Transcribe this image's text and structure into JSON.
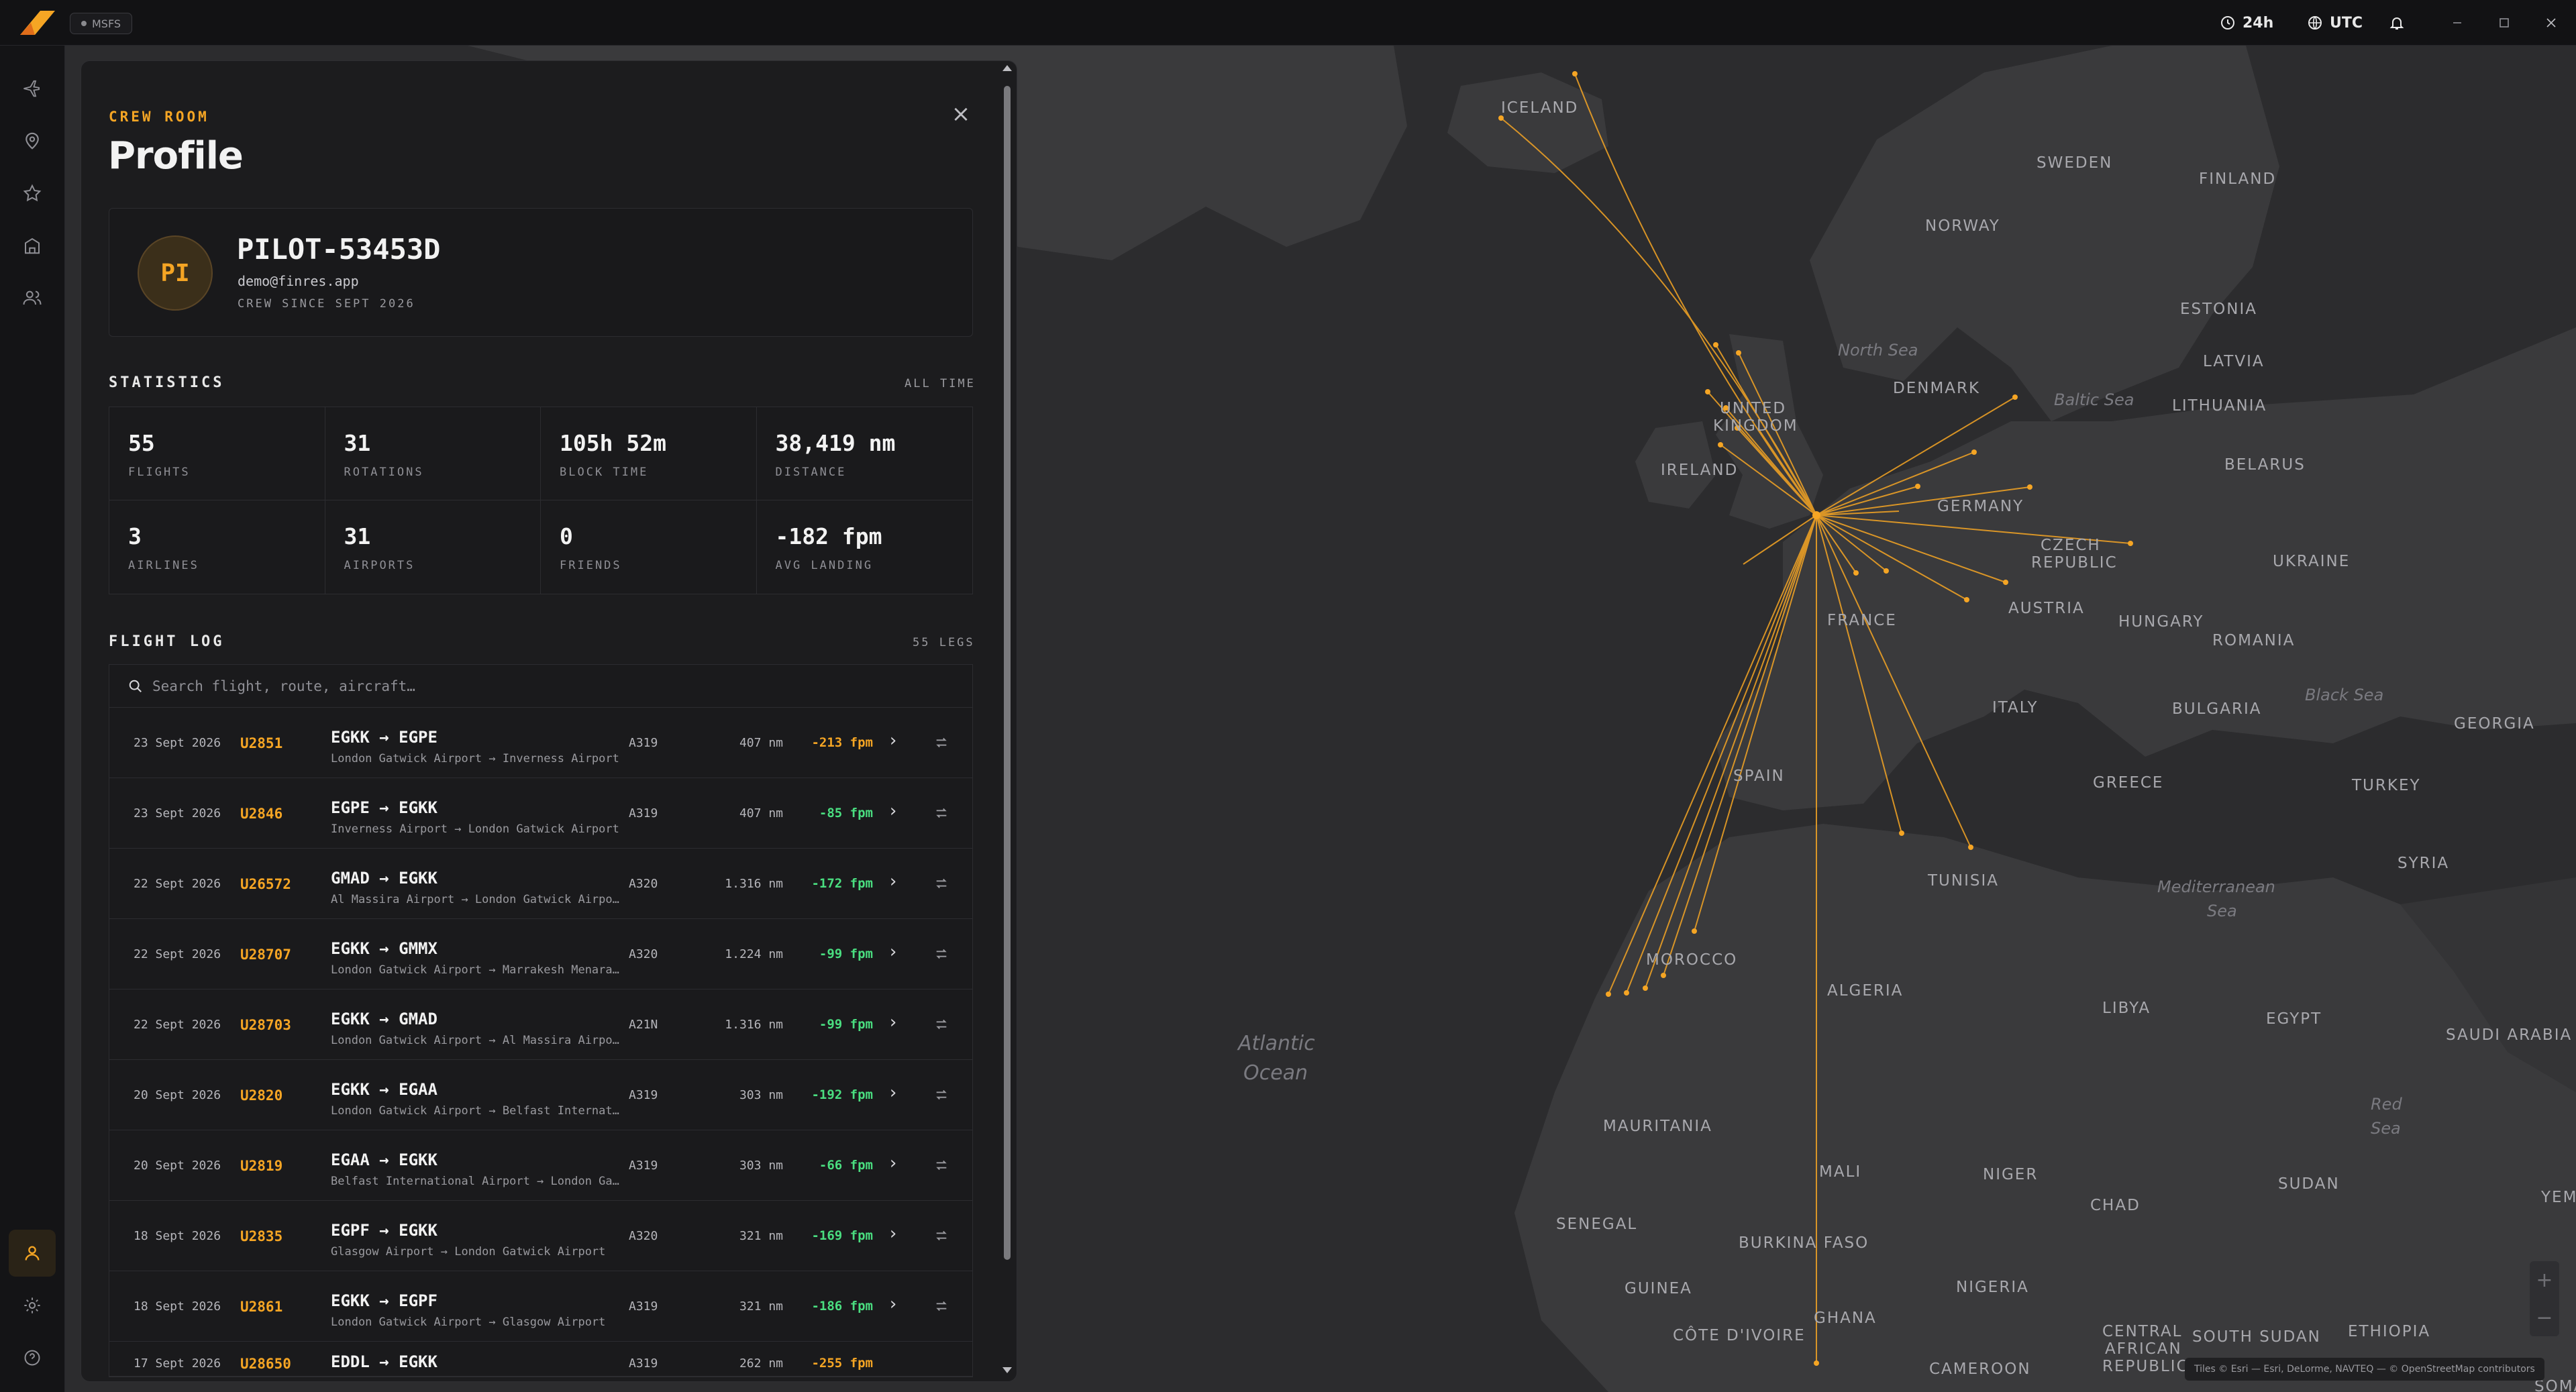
{
  "titlebar": {
    "sim_badge": "MSFS",
    "clock_mode": "24h",
    "timezone": "UTC",
    "accent": "#f5a524"
  },
  "sidebar": {
    "items": [
      "plane-icon",
      "map-pin-icon",
      "star-icon",
      "building-icon",
      "users-icon"
    ],
    "bottom": [
      "user-icon",
      "gear-icon",
      "help-icon"
    ]
  },
  "panel": {
    "kicker": "CREW ROOM",
    "title": "Profile",
    "close": "×",
    "profile": {
      "initials": "PI",
      "callsign": "PILOT-53453D",
      "email": "demo@finres.app",
      "since": "CREW SINCE SEPT 2026"
    },
    "statistics": {
      "heading": "STATISTICS",
      "range": "ALL TIME",
      "items": [
        {
          "value": "55",
          "label": "FLIGHTS"
        },
        {
          "value": "31",
          "label": "ROTATIONS"
        },
        {
          "value": "105h 52m",
          "label": "BLOCK TIME"
        },
        {
          "value": "38,419 nm",
          "label": "DISTANCE"
        },
        {
          "value": "3",
          "label": "AIRLINES"
        },
        {
          "value": "31",
          "label": "AIRPORTS"
        },
        {
          "value": "0",
          "label": "FRIENDS"
        },
        {
          "value": "-182 fpm",
          "label": "AVG LANDING"
        }
      ]
    },
    "flight_log": {
      "heading": "FLIGHT LOG",
      "count": "55 LEGS",
      "search_placeholder": "Search flight, route, aircraft…",
      "rows": [
        {
          "date": "23 Sept 2026",
          "flight": "U2851",
          "route": "EGKK → EGPE",
          "names": "London Gatwick Airport → Inverness Airport",
          "aircraft": "A319",
          "distance": "407 nm",
          "fpm": "-213 fpm",
          "fpm_color": "#f5a524"
        },
        {
          "date": "23 Sept 2026",
          "flight": "U2846",
          "route": "EGPE → EGKK",
          "names": "Inverness Airport → London Gatwick Airport",
          "aircraft": "A319",
          "distance": "407 nm",
          "fpm": "-85 fpm",
          "fpm_color": "#4ade80"
        },
        {
          "date": "22 Sept 2026",
          "flight": "U26572",
          "route": "GMAD → EGKK",
          "names": "Al Massira Airport → London Gatwick Airport",
          "aircraft": "A320",
          "distance": "1.316 nm",
          "fpm": "-172 fpm",
          "fpm_color": "#4ade80"
        },
        {
          "date": "22 Sept 2026",
          "flight": "U28707",
          "route": "EGKK → GMMX",
          "names": "London Gatwick Airport → Marrakesh Menara A...",
          "aircraft": "A320",
          "distance": "1.224 nm",
          "fpm": "-99 fpm",
          "fpm_color": "#4ade80"
        },
        {
          "date": "22 Sept 2026",
          "flight": "U28703",
          "route": "EGKK → GMAD",
          "names": "London Gatwick Airport → Al Massira Airport",
          "aircraft": "A21N",
          "distance": "1.316 nm",
          "fpm": "-99 fpm",
          "fpm_color": "#4ade80"
        },
        {
          "date": "20 Sept 2026",
          "flight": "U2820",
          "route": "EGKK → EGAA",
          "names": "London Gatwick Airport → Belfast International ...",
          "aircraft": "A319",
          "distance": "303 nm",
          "fpm": "-192 fpm",
          "fpm_color": "#4ade80"
        },
        {
          "date": "20 Sept 2026",
          "flight": "U2819",
          "route": "EGAA → EGKK",
          "names": "Belfast International Airport → London Gatwick ...",
          "aircraft": "A319",
          "distance": "303 nm",
          "fpm": "-66 fpm",
          "fpm_color": "#4ade80"
        },
        {
          "date": "18 Sept 2026",
          "flight": "U2835",
          "route": "EGPF → EGKK",
          "names": "Glasgow Airport → London Gatwick Airport",
          "aircraft": "A320",
          "distance": "321 nm",
          "fpm": "-169 fpm",
          "fpm_color": "#4ade80"
        },
        {
          "date": "18 Sept 2026",
          "flight": "U2861",
          "route": "EGKK → EGPF",
          "names": "London Gatwick Airport → Glasgow Airport",
          "aircraft": "A319",
          "distance": "321 nm",
          "fpm": "-186 fpm",
          "fpm_color": "#4ade80"
        },
        {
          "date": "17 Sept 2026",
          "flight": "U28650",
          "route": "EDDL → EGKK",
          "names": "",
          "aircraft": "A319",
          "distance": "262 nm",
          "fpm": "-255 fpm",
          "fpm_color": "#f5a524"
        }
      ]
    }
  },
  "map": {
    "labels": [
      "ICELAND",
      "SWEDEN",
      "FINLAND",
      "NORWAY",
      "ESTONIA",
      "LATVIA",
      "DENMARK",
      "LITHUANIA",
      "UNITED",
      "KINGDOM",
      "IRELAND",
      "BELARUS",
      "GERMANY",
      "CZECH",
      "REPUBLIC",
      "UKRAINE",
      "FRANCE",
      "AUSTRIA",
      "HUNGARY",
      "ROMANIA",
      "ITALY",
      "BULGARIA",
      "GEORGIA",
      "SPAIN",
      "GREECE",
      "TURKEY",
      "TUNISIA",
      "SYRIA",
      "MOROCCO",
      "ALGERIA",
      "LIBYA",
      "EGYPT",
      "SAUDI ARABIA",
      "MAURITANIA",
      "MALI",
      "NIGER",
      "SUDAN",
      "CHAD",
      "SENEGAL",
      "BURKINA FASO",
      "GUINEA",
      "NIGERIA",
      "GHANA",
      "CÔTE D'IVOIRE",
      "CENTRAL",
      "AFRICAN",
      "REPUBLIC",
      "SOUTH SUDAN",
      "ETHIOPIA",
      "CAMEROON",
      "YEM",
      "SOMALIA"
    ],
    "seas": [
      "North Sea",
      "Baltic Sea",
      "Black Sea",
      "Mediterranean",
      "Sea",
      "Atlantic",
      "Ocean",
      "Red",
      "Sea"
    ],
    "attribution": "Tiles © Esri — Esri, DeLorme, NAVTEQ — © OpenStreetMap contributors",
    "zoom_in": "+",
    "zoom_out": "−"
  }
}
